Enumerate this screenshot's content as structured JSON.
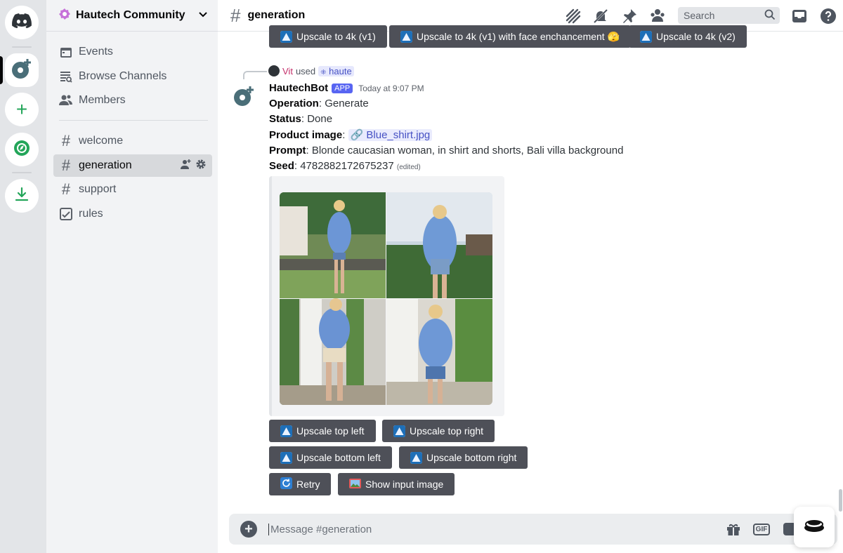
{
  "colors": {
    "accent": "#5865f2",
    "button_bg": "#4e5058",
    "green": "#23a559",
    "mention_bg": "#e6e8fd"
  },
  "rail": {
    "items": [
      {
        "name": "discord-home",
        "icon": "discord-logo-icon"
      },
      {
        "name": "hautech-server",
        "icon": "hautech-logo-icon"
      },
      {
        "name": "add-server",
        "icon": "plus-icon"
      },
      {
        "name": "explore",
        "icon": "compass-icon"
      },
      {
        "name": "download-apps",
        "icon": "download-icon"
      }
    ]
  },
  "guild": {
    "name": "Hautech Community",
    "icon": "hautech-badge-icon"
  },
  "sidebar": {
    "nav": [
      {
        "label": "Events",
        "icon": "calendar-icon"
      },
      {
        "label": "Browse Channels",
        "icon": "browse-channels-icon"
      },
      {
        "label": "Members",
        "icon": "members-icon"
      }
    ],
    "channels": [
      {
        "label": "welcome",
        "icon": "hash-icon"
      },
      {
        "label": "generation",
        "icon": "hash-icon",
        "active": true
      },
      {
        "label": "support",
        "icon": "hash-icon"
      },
      {
        "label": "rules",
        "icon": "rules-icon"
      }
    ]
  },
  "header": {
    "channel": "generation",
    "search_placeholder": "Search",
    "icons": [
      "threads-icon",
      "mute-bell-icon",
      "pin-icon",
      "member-list-icon",
      "search-icon",
      "inbox-icon",
      "help-icon"
    ]
  },
  "top_buttons": [
    "Upscale to 4k (v1)",
    "Upscale to 4k (v1) with face enchancement 🫣",
    "Upscale to 4k (v2)"
  ],
  "message": {
    "reply": {
      "user": "Vit",
      "used": "used",
      "command": "haute"
    },
    "author": "HautechBot",
    "tag": "APP",
    "time": "Today at 9:07 PM",
    "fields": [
      {
        "key": "Operation",
        "value": "Generate"
      },
      {
        "key": "Status",
        "value": "Done"
      },
      {
        "key": "Product image",
        "value": "Blue_shirt.jpg"
      },
      {
        "key": "Prompt",
        "value": "Blonde caucasian woman, in shirt and shorts, Bali villa background"
      },
      {
        "key": "Seed",
        "value": "4782882172675237"
      }
    ],
    "edited": "(edited)",
    "image_grid": [
      "top-left",
      "top-right",
      "bottom-left",
      "bottom-right"
    ]
  },
  "action_buttons": {
    "upscale_top_left": "Upscale top left",
    "upscale_top_right": "Upscale top right",
    "upscale_bottom_left": "Upscale bottom left",
    "upscale_bottom_right": "Upscale bottom right",
    "retry": "Retry",
    "show_input": "Show input image"
  },
  "composer": {
    "placeholder": "Message #generation",
    "gif": "GIF",
    "icons": [
      "add-attachment-icon",
      "gift-icon",
      "gif-icon",
      "sticker-icon"
    ]
  }
}
